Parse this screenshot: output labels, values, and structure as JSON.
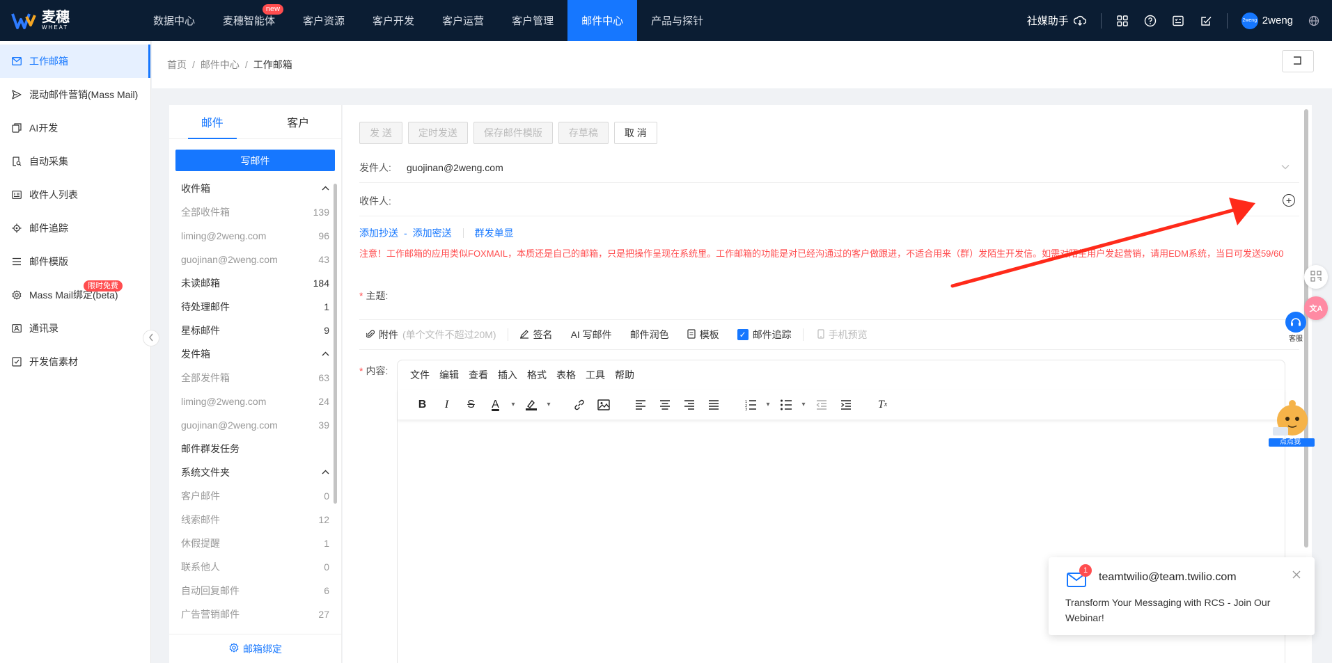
{
  "brand": {
    "name": "麦穗",
    "sub": "WHEAT"
  },
  "topnav": {
    "items": [
      {
        "label": "数据中心"
      },
      {
        "label": "麦穗智能体",
        "badge": "new"
      },
      {
        "label": "客户资源"
      },
      {
        "label": "客户开发"
      },
      {
        "label": "客户运营"
      },
      {
        "label": "客户管理"
      },
      {
        "label": "邮件中心",
        "active": true
      },
      {
        "label": "产品与探针"
      }
    ],
    "media_helper": "社媒助手",
    "user": "2weng",
    "avatar_text": "2weng"
  },
  "sidebar": {
    "items": [
      {
        "label": "工作邮箱",
        "icon": "mail-icon",
        "active": true
      },
      {
        "label": "混动邮件营销(Mass Mail)",
        "icon": "send-icon"
      },
      {
        "label": "AI开发",
        "icon": "copy-icon"
      },
      {
        "label": "自动采集",
        "icon": "doc-search-icon"
      },
      {
        "label": "收件人列表",
        "icon": "contact-card-icon"
      },
      {
        "label": "邮件追踪",
        "icon": "target-icon"
      },
      {
        "label": "邮件模版",
        "icon": "list-icon"
      },
      {
        "label": "Mass Mail绑定(beta)",
        "icon": "gear-icon",
        "badge": "限时免费"
      },
      {
        "label": "通讯录",
        "icon": "address-book-icon"
      },
      {
        "label": "开发信素材",
        "icon": "checklist-icon"
      }
    ]
  },
  "breadcrumb": {
    "home": "首页",
    "section": "邮件中心",
    "current": "工作邮箱"
  },
  "folders": {
    "tabs": [
      "邮件",
      "客户"
    ],
    "compose_label": "写邮件",
    "inbox": {
      "title": "收件箱",
      "rows": [
        {
          "label": "全部收件箱",
          "count": "139"
        },
        {
          "label": "liming@2weng.com",
          "count": "96"
        },
        {
          "label": "guojinan@2weng.com",
          "count": "43"
        }
      ]
    },
    "unread": {
      "label": "未读邮箱",
      "count": "184"
    },
    "pending": {
      "label": "待处理邮件",
      "count": "1"
    },
    "starred": {
      "label": "星标邮件",
      "count": "9"
    },
    "sent": {
      "title": "发件箱",
      "rows": [
        {
          "label": "全部发件箱",
          "count": "63"
        },
        {
          "label": "liming@2weng.com",
          "count": "24"
        },
        {
          "label": "guojinan@2weng.com",
          "count": "39"
        }
      ]
    },
    "mass_task": "邮件群发任务",
    "system": {
      "title": "系统文件夹",
      "rows": [
        {
          "label": "客户邮件",
          "count": "0"
        },
        {
          "label": "线索邮件",
          "count": "12"
        },
        {
          "label": "休假提醒",
          "count": "1"
        },
        {
          "label": "联系他人",
          "count": "0"
        },
        {
          "label": "自动回复邮件",
          "count": "6"
        },
        {
          "label": "广告营销邮件",
          "count": "27"
        }
      ]
    },
    "bind_label": "邮箱绑定"
  },
  "compose": {
    "buttons": {
      "send": "发 送",
      "schedule": "定时发送",
      "save_template": "保存邮件模版",
      "draft": "存草稿",
      "cancel": "取 消"
    },
    "sender_label": "发件人:",
    "sender_value": "guojinan@2weng.com",
    "recipient_label": "收件人:",
    "add_cc": "添加抄送",
    "dash": "-",
    "add_bcc": "添加密送",
    "mass_single": "群发单显",
    "notice": "注意！工作邮箱的应用类似FOXMAIL，本质还是自己的邮箱，只是把操作呈现在系统里。工作邮箱的功能是对已经沟通过的客户做跟进，不适合用来（群）发陌生开发信。如需对陌生用户发起营销，请用EDM系统，当日可发送59/60",
    "subject_label": "主题:",
    "attach_label": "附件",
    "attach_hint": "(单个文件不超过20M)",
    "signature": "签名",
    "ai_write": "AI 写邮件",
    "polish": "邮件润色",
    "template": "模板",
    "tracking": "邮件追踪",
    "mobile_preview": "手机预览",
    "content_label": "内容:",
    "menu": [
      "文件",
      "编辑",
      "查看",
      "插入",
      "格式",
      "表格",
      "工具",
      "帮助"
    ]
  },
  "floating": {
    "kefu": "客服",
    "mascot": "点点我"
  },
  "notification": {
    "count": "1",
    "from": "teamtwilio@team.twilio.com",
    "message": "Transform Your Messaging with RCS - Join Our Webinar!"
  },
  "colors": {
    "nav_bg": "#0b1d33",
    "accent": "#1677ff",
    "warning": "#ff4d4f",
    "arrow": "#ff2a1a"
  }
}
